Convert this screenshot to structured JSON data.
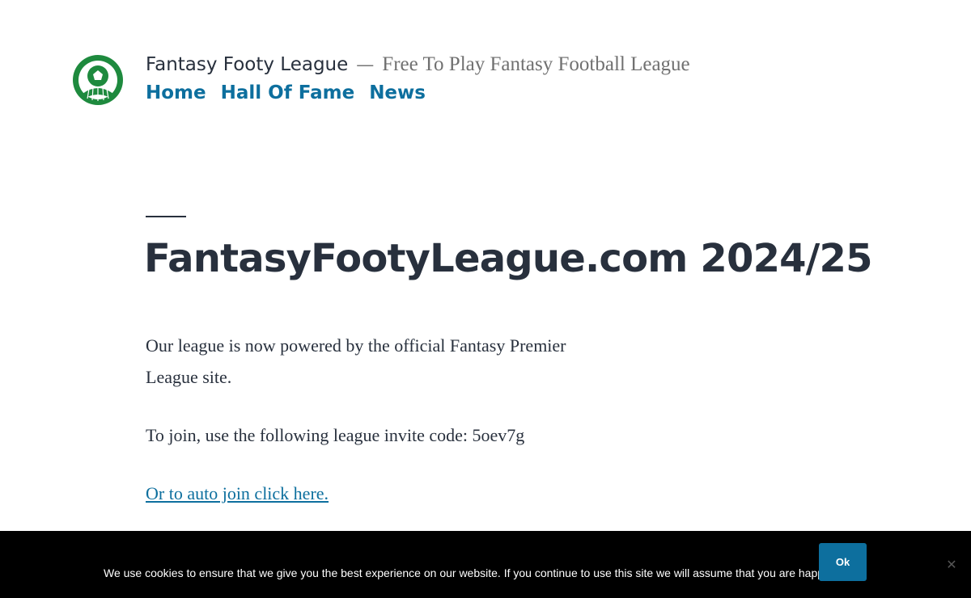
{
  "header": {
    "site_title": "Fantasy Footy League",
    "separator": "—",
    "tagline": "Free To Play Fantasy Football League",
    "nav": [
      {
        "label": "Home"
      },
      {
        "label": "Hall Of Fame"
      },
      {
        "label": "News"
      }
    ],
    "logo_icon": "soccer-ball-logo-icon"
  },
  "post": {
    "title": "FantasyFootyLeague.com 2024/25",
    "paragraph1": "Our league is now powered by the official Fantasy Premier League site.",
    "paragraph2": "To join, use the following league invite code: 5oev7g",
    "link_text": "Or to auto join click here."
  },
  "cookie": {
    "message": "We use cookies to ensure that we give you the best experience on our website. If you continue to use this site we will assume that you are happy with it.",
    "ok_label": "Ok",
    "close_glyph": "✕"
  },
  "colors": {
    "accent": "#0d6f9e",
    "text": "#28303d",
    "logo_green": "#1e8a3e",
    "cookie_bg": "#000000"
  }
}
